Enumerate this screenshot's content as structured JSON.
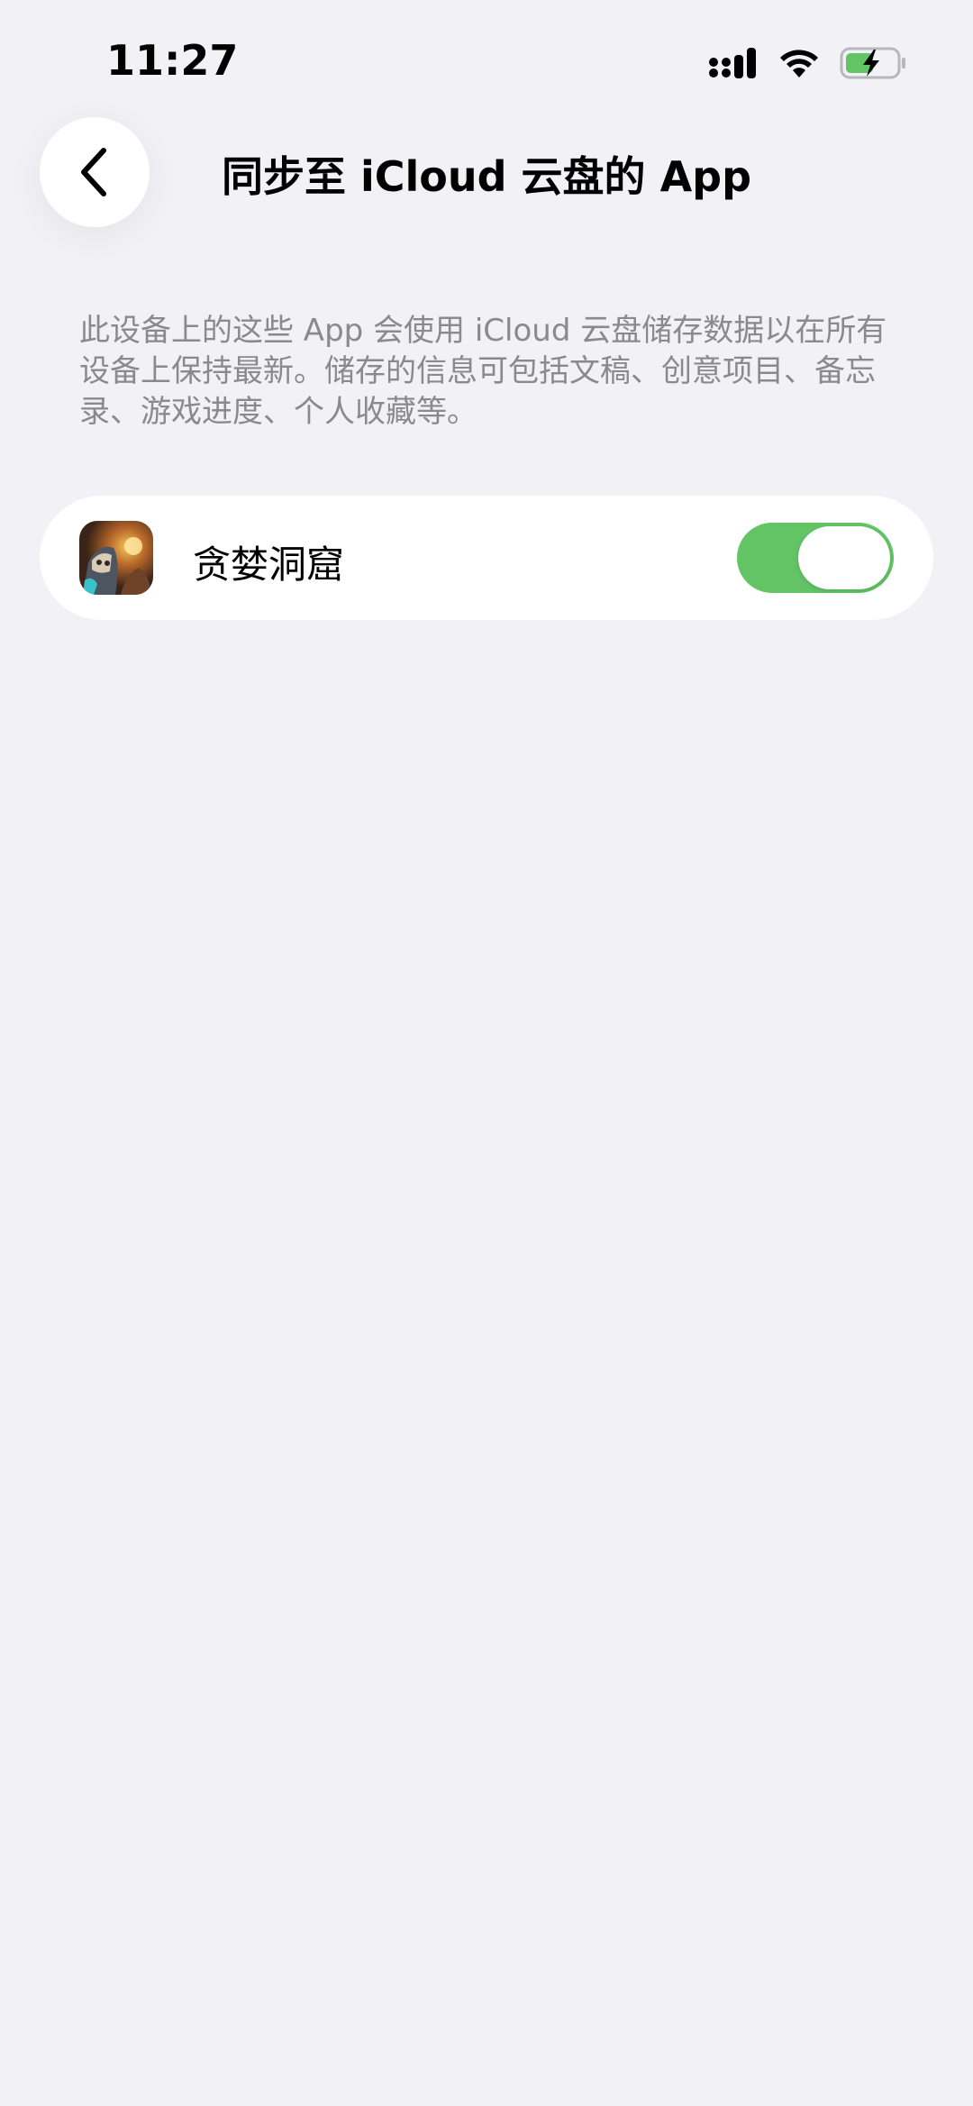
{
  "status_bar": {
    "time": "11:27",
    "signal_icon": "cellular-signal-icon",
    "wifi_icon": "wifi-icon",
    "battery_icon": "battery-charging-icon",
    "battery_color": "#63c466"
  },
  "header": {
    "back_icon": "chevron-left-icon",
    "title": "同步至 iCloud 云盘的 App"
  },
  "description": "此设备上的这些 App 会使用 iCloud 云盘储存数据以在所有设备上保持最新。储存的信息可包括文稿、创意项目、备忘录、游戏进度、个人收藏等。",
  "apps": [
    {
      "name": "贪婪洞窟",
      "icon": "app-icon-greedy-cave",
      "sync_enabled": true
    }
  ],
  "colors": {
    "background": "#f2f1f6",
    "card": "#ffffff",
    "toggle_on": "#63c466",
    "secondary_text": "#8a8a8e"
  }
}
